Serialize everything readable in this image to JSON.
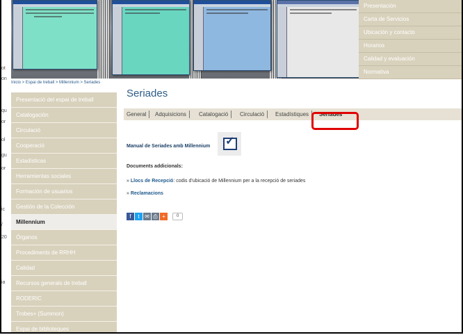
{
  "left_fragments": [
    "ot",
    "on",
    "qu",
    "or",
    "ol",
    "gu",
    "or",
    "ic",
    "/",
    "20",
    "ia"
  ],
  "top_menu": [
    "Presentación",
    "Carta de Servicios",
    "Ubicación y contacto",
    "Horarios",
    "Calidad y evaluación",
    "Normativa"
  ],
  "breadcrumb": "Inicio > Espai de treball > Millennium > Seriades",
  "sidebar": [
    {
      "label": "Presentació del espai de treball",
      "active": false
    },
    {
      "label": "Catalogación",
      "active": false
    },
    {
      "label": "Circulació",
      "active": false
    },
    {
      "label": "Cooperació",
      "active": false
    },
    {
      "label": "Estadísticas",
      "active": false
    },
    {
      "label": "Herramientas sociales",
      "active": false
    },
    {
      "label": "Formación de usuarios",
      "active": false
    },
    {
      "label": "Gestión de la Colección",
      "active": false
    },
    {
      "label": "Millennium",
      "active": true
    },
    {
      "label": "Órganos",
      "active": false
    },
    {
      "label": "Procediments de RRHH",
      "active": false
    },
    {
      "label": "Calidad",
      "active": false
    },
    {
      "label": "Recursos generals de treball",
      "active": false
    },
    {
      "label": "RODERIC",
      "active": false
    },
    {
      "label": "Trobes+ (Summon)",
      "active": false
    },
    {
      "label": "Espai de biblioteques",
      "active": false
    }
  ],
  "main": {
    "title": "Seriades",
    "tabs": [
      {
        "label": "General",
        "active": false
      },
      {
        "label": "Adquisicions",
        "active": false
      },
      {
        "label": "Catalogació",
        "active": false
      },
      {
        "label": "Circulació",
        "active": false
      },
      {
        "label": "Estadístiques",
        "active": false
      },
      {
        "label": "Seriades",
        "active": true
      }
    ],
    "manual_link": "Manual de Seriades amb Millennium",
    "docs_heading": "Documents addicionals:",
    "links": [
      {
        "bullet": "»",
        "link": "Llocs de Recepció",
        "rest": ": codis d'ubicació de Millennium per a la recepció de seriades"
      },
      {
        "bullet": "»",
        "link": "Reclamacions",
        "rest": ""
      }
    ],
    "share_count": "0",
    "share_icons": [
      {
        "name": "facebook-icon",
        "color": "#3b5998",
        "glyph": "f"
      },
      {
        "name": "twitter-icon",
        "color": "#1da1f2",
        "glyph": "t"
      },
      {
        "name": "email-icon",
        "color": "#6b7b8c",
        "glyph": "✉"
      },
      {
        "name": "print-icon",
        "color": "#6b7b8c",
        "glyph": "⎙"
      },
      {
        "name": "plus-icon",
        "color": "#f06b27",
        "glyph": "+"
      }
    ]
  },
  "colors": {
    "sidebar_bg": "#d8d1bc",
    "accent": "#2d5c86",
    "highlight": "#e00000"
  }
}
